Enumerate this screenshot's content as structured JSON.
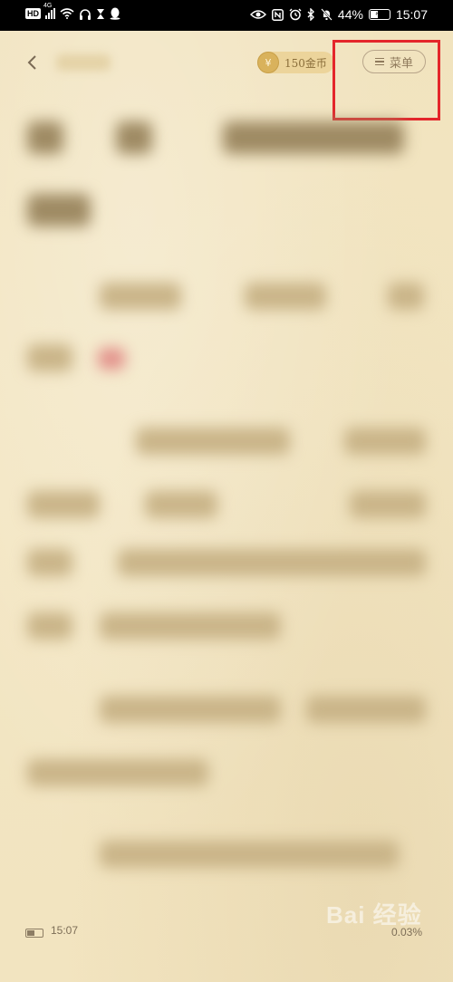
{
  "status_bar": {
    "hd": "HD",
    "network": "4G",
    "battery": "44%",
    "battery_level": 0.44,
    "time": "15:07",
    "icons": [
      "hd-icon",
      "signal-icon",
      "wifi-icon",
      "headphones-icon",
      "hourglass-icon",
      "qq-icon",
      "eye-icon",
      "nfc-icon",
      "alarm-icon",
      "bluetooth-icon",
      "mute-icon",
      "battery-icon"
    ]
  },
  "reader": {
    "coins_symbol": "¥",
    "coins_label": "150金币",
    "menu_label": "菜单",
    "highlight_color": "#e4262b",
    "background_color": "#f2e4c0"
  },
  "footer": {
    "time": "15:07",
    "progress": "0.03%",
    "watermark": "Bai 经验"
  }
}
